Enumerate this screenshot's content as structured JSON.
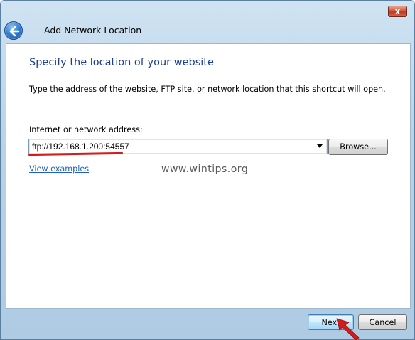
{
  "window": {
    "title": "Add Network Location",
    "close_glyph": "x"
  },
  "icons": {
    "back": "back-arrow-icon",
    "close": "close-icon",
    "dropdown": "chevron-down-icon"
  },
  "main": {
    "heading": "Specify the location of your website",
    "instruction": "Type the address of the website, FTP site, or network location that this shortcut will open.",
    "address_label": "Internet or network address:",
    "address_value": "ftp://192.168.1.200:54557",
    "browse_label": "Browse...",
    "view_examples_label": "View examples",
    "watermark": "www.wintips.org"
  },
  "footer": {
    "next_label": "Next",
    "cancel_label": "Cancel"
  },
  "colors": {
    "heading": "#1b3f8f",
    "link": "#1f5fbf",
    "annotation_red": "#d21c1c",
    "titlebar": "#b9d3e8"
  }
}
